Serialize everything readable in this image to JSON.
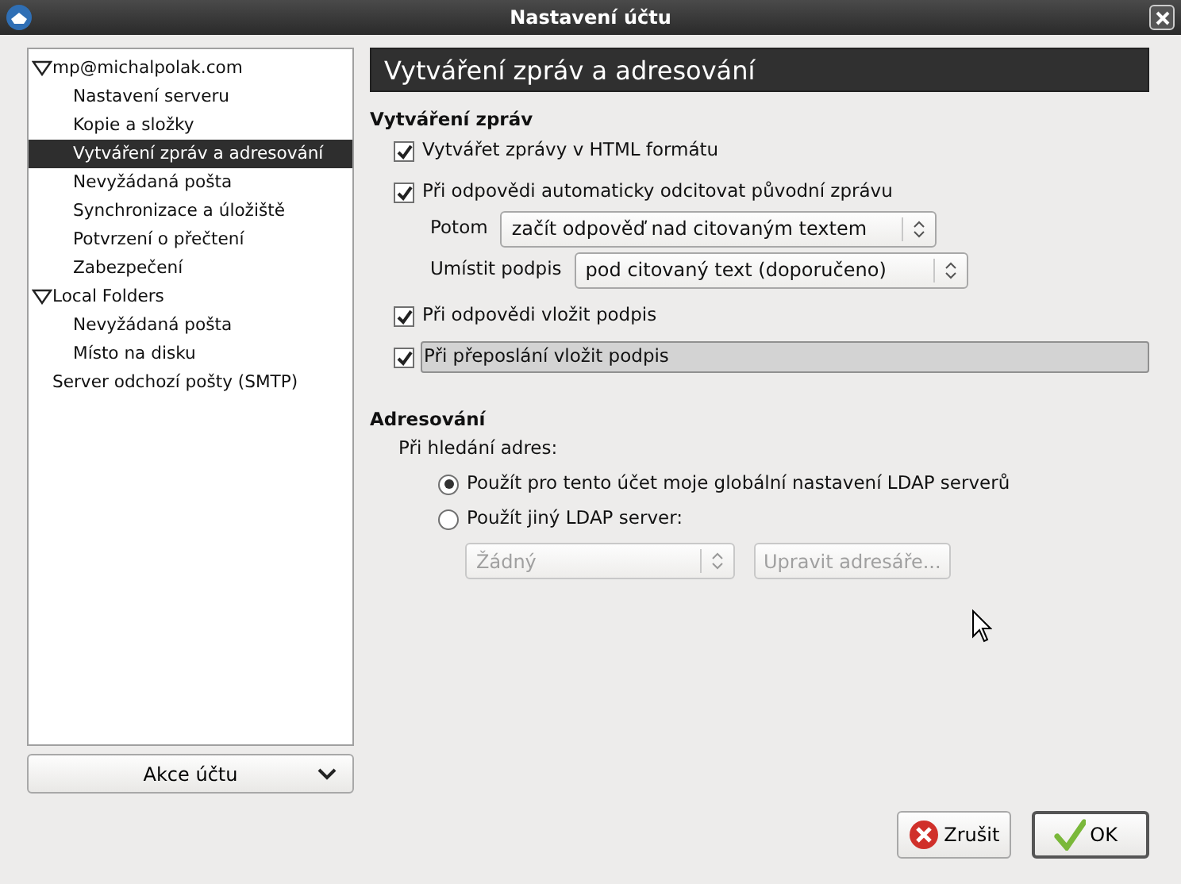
{
  "window": {
    "title": "Nastavení účtu"
  },
  "tree": [
    {
      "label": "mp@michalpolak.com",
      "expanded": true,
      "selected": false,
      "children": [
        {
          "label": "Nastavení serveru",
          "selected": false
        },
        {
          "label": "Kopie a složky",
          "selected": false
        },
        {
          "label": "Vytváření zpráv a adresování",
          "selected": true
        },
        {
          "label": "Nevyžádaná pošta",
          "selected": false
        },
        {
          "label": "Synchronizace a úložiště",
          "selected": false
        },
        {
          "label": "Potvrzení o přečtení",
          "selected": false
        },
        {
          "label": "Zabezpečení",
          "selected": false
        }
      ]
    },
    {
      "label": "Local Folders",
      "expanded": true,
      "selected": false,
      "children": [
        {
          "label": "Nevyžádaná pošta",
          "selected": false
        },
        {
          "label": "Místo na disku",
          "selected": false
        }
      ]
    },
    {
      "label": "Server odchozí pošty (SMTP)",
      "selected": false
    }
  ],
  "account_actions": {
    "label": "Akce účtu"
  },
  "panel": {
    "title": "Vytváření zpráv a adresování"
  },
  "composition": {
    "heading": "Vytváření zpráv",
    "items": [
      {
        "kind": "checkbox",
        "label": "Vytvářet zprávy v HTML formátu",
        "checked": true,
        "focused": false
      },
      {
        "kind": "checkbox",
        "label": "Při odpovědi automaticky odcitovat původní zprávu",
        "checked": true,
        "focused": false
      },
      {
        "kind": "select",
        "label": "Potom",
        "value": "začít odpověď nad citovaným textem"
      },
      {
        "kind": "select",
        "label": "Umístit podpis",
        "value": "pod citovaný text (doporučeno)"
      },
      {
        "kind": "checkbox",
        "label": "Při odpovědi vložit podpis",
        "checked": true,
        "focused": false
      },
      {
        "kind": "checkbox",
        "label": "Při přeposlání vložit podpis",
        "checked": true,
        "focused": true
      }
    ]
  },
  "addressing": {
    "heading": "Adresování",
    "prompt": "Při hledání adres:",
    "options": [
      {
        "label": "Použít pro tento účet moje globální nastavení LDAP serverů",
        "selected": true
      },
      {
        "label": "Použít jiný LDAP server:",
        "selected": false
      }
    ],
    "server_select": {
      "value": "Žádný",
      "disabled": true
    },
    "edit_button": {
      "label": "Upravit adresáře...",
      "disabled": true
    }
  },
  "buttons": [
    {
      "kind": "cancel",
      "label": "Zrušit",
      "default": false
    },
    {
      "kind": "ok",
      "label": "OK",
      "default": true
    }
  ]
}
